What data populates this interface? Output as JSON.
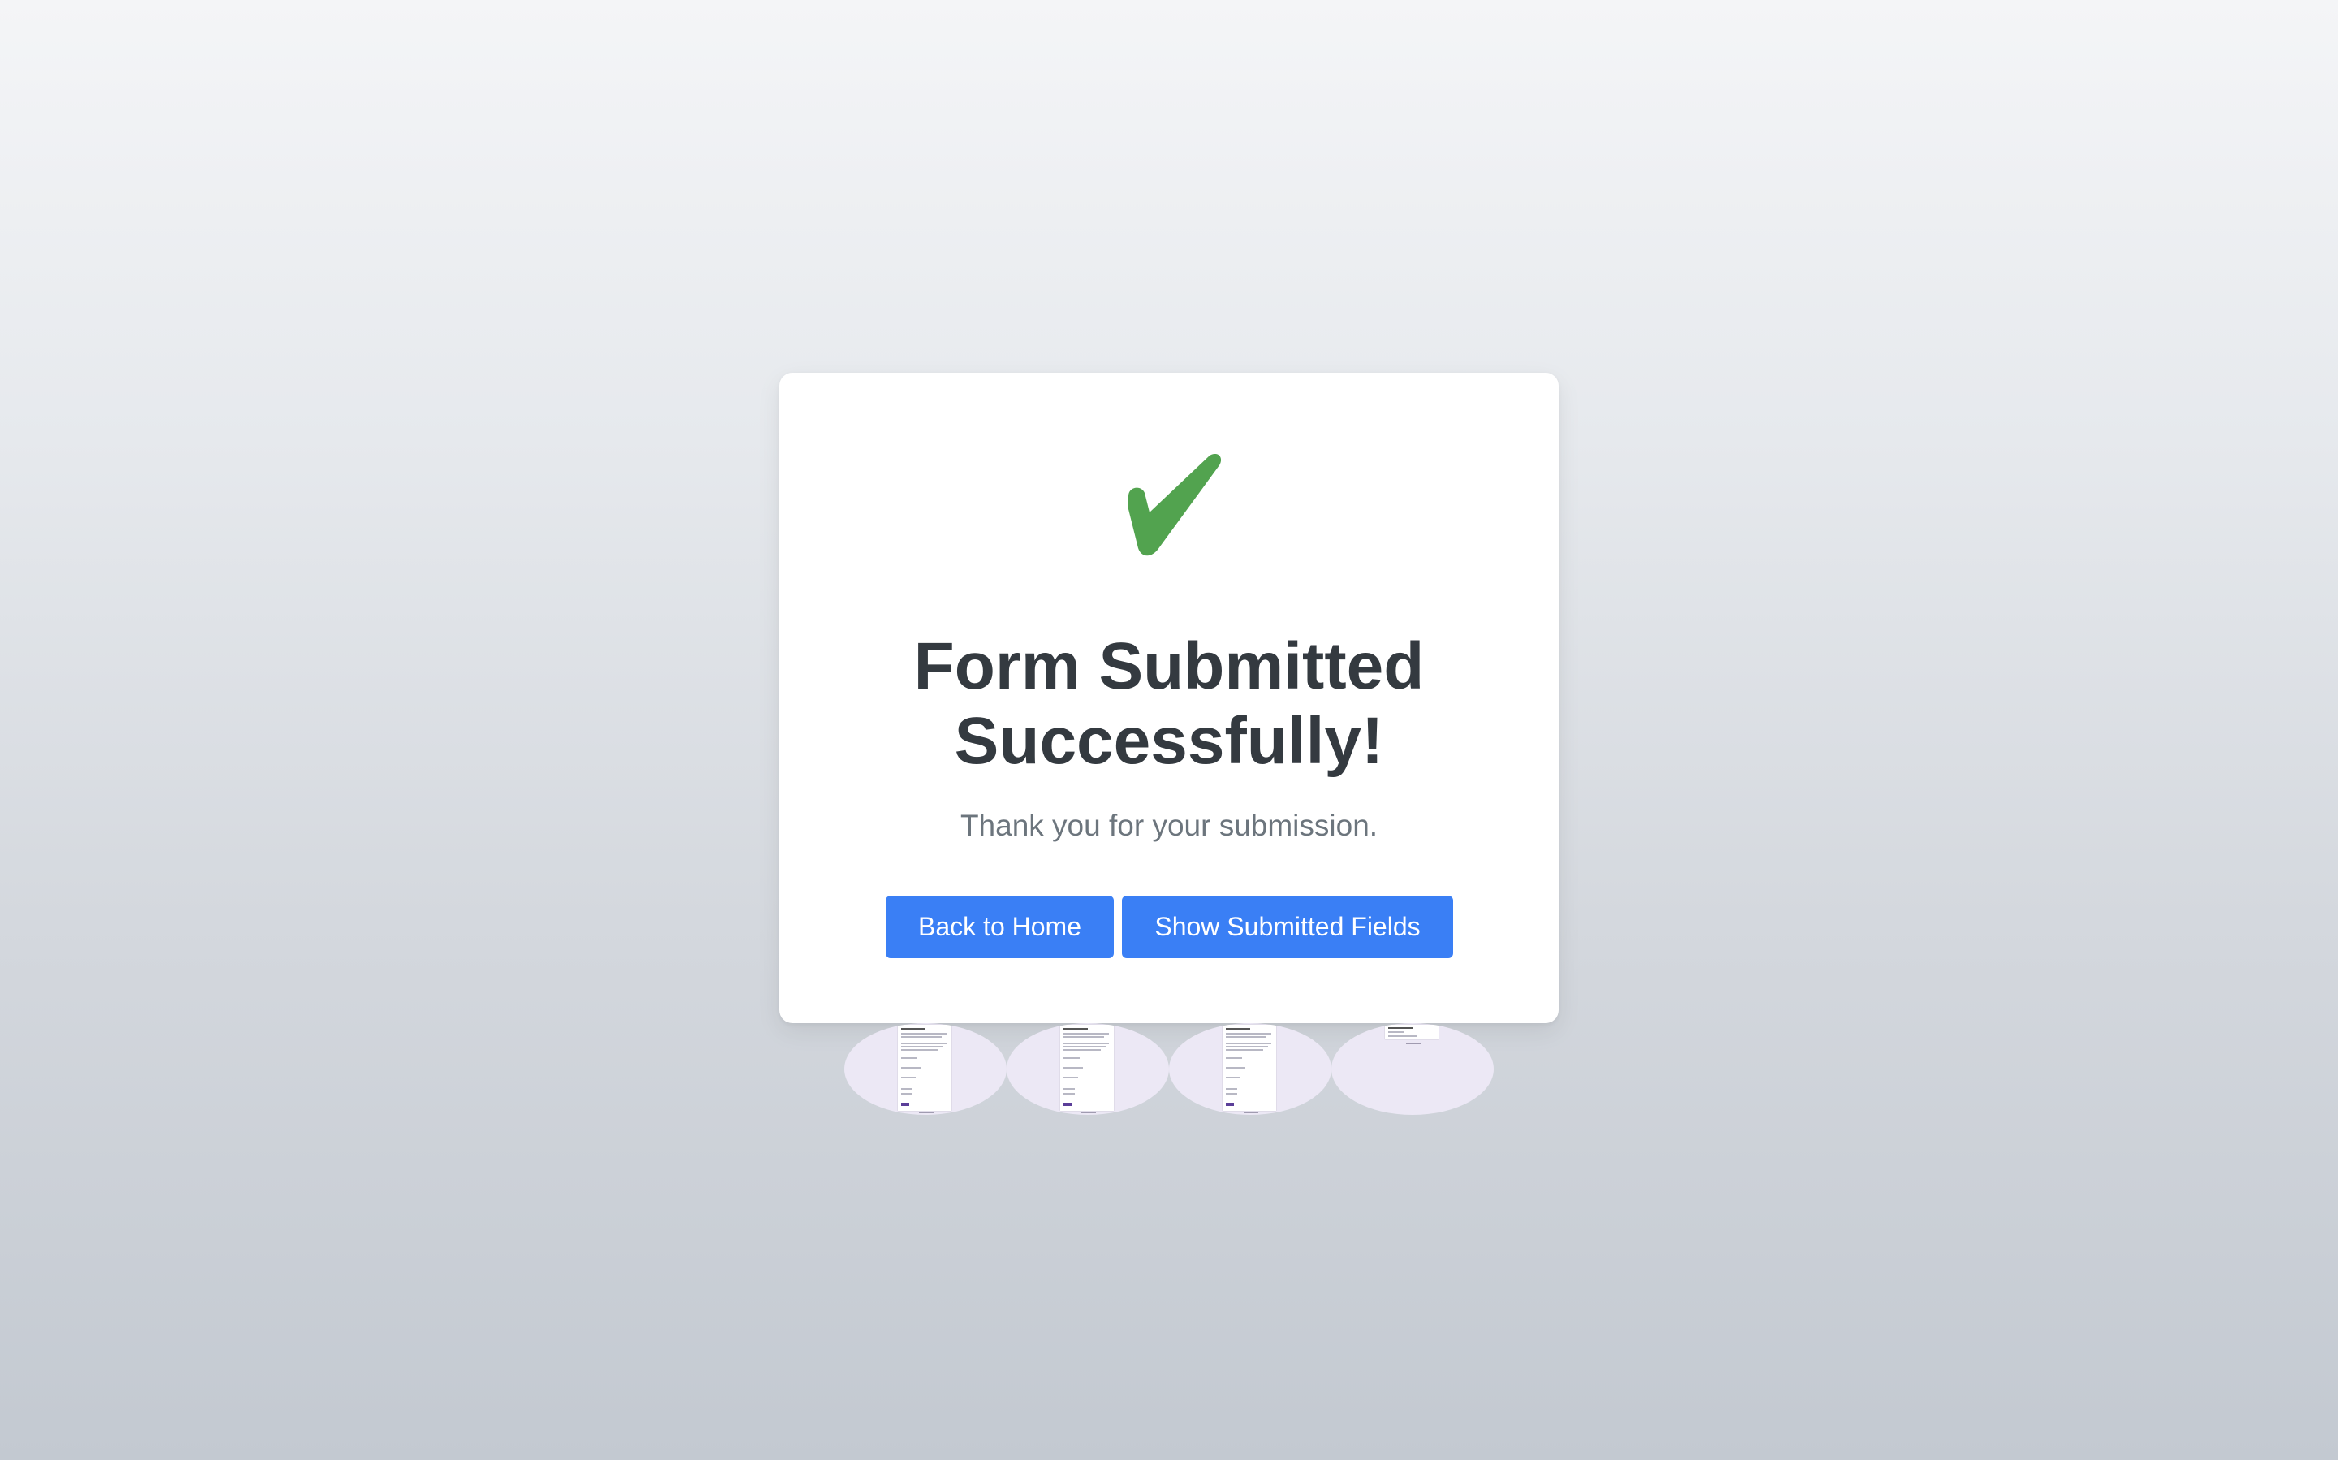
{
  "success": {
    "title": "Form Submitted Successfully!",
    "message": "Thank you for your submission.",
    "icon": "checkmark-icon",
    "icon_color": "#52a34f"
  },
  "actions": {
    "back_home_label": "Back to Home",
    "show_fields_label": "Show Submitted Fields",
    "button_color": "#3a7ff5"
  },
  "thumbnails": {
    "count": 4
  }
}
